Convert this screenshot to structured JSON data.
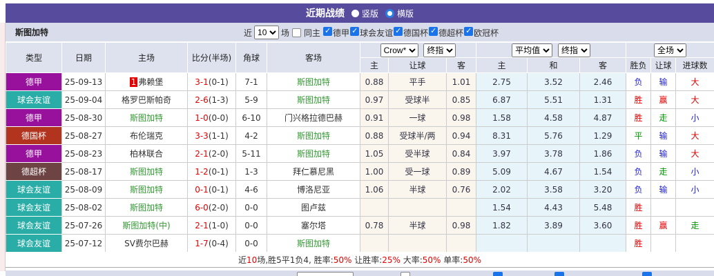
{
  "title_bar": {
    "title": "近期战绩",
    "radio_vertical": "竖版",
    "radio_horizontal": "横版",
    "selected": "横版"
  },
  "toolbar": {
    "team": "斯图加特",
    "near_label": "近",
    "near_value": "10",
    "games_label": "场",
    "same_home_label": "同主",
    "same_home_checked": false,
    "leagues": [
      {
        "label": "德甲",
        "checked": true
      },
      {
        "label": "球会友谊",
        "checked": true
      },
      {
        "label": "德国杯",
        "checked": true
      },
      {
        "label": "德超杯",
        "checked": true
      },
      {
        "label": "欧冠杯",
        "checked": true
      }
    ]
  },
  "header": {
    "static": [
      "类型",
      "日期",
      "主场",
      "比分(半场)",
      "角球",
      "客场"
    ],
    "odds_select_1": "Crow*",
    "odds_select_2": "终指",
    "avg_select_1": "平均值",
    "avg_select_2": "终指",
    "scope_select": "全场",
    "sub": [
      "主",
      "让球",
      "客",
      "主",
      "和",
      "客",
      "胜负",
      "让球",
      "进球数"
    ]
  },
  "type_colors": {
    "德甲": "#98119c",
    "球会友谊": "#29ada6",
    "德国杯": "#b2341f",
    "德超杯": "#6d4344"
  },
  "rows": [
    {
      "type": "德甲",
      "date": "25-09-13",
      "home": "弗赖堡",
      "home_rank": "1",
      "home_green": false,
      "score": "3-1",
      "half": "(0-1)",
      "corner": "7-1",
      "away": "斯图加特",
      "away_green": true,
      "odds": [
        "0.88",
        "平手",
        "1.01"
      ],
      "avg": [
        "2.75",
        "3.52",
        "2.46"
      ],
      "wdl": [
        "负",
        "blue"
      ],
      "let": [
        "输",
        "blue"
      ],
      "goals": [
        "大",
        "red"
      ]
    },
    {
      "type": "球会友谊",
      "date": "25-09-04",
      "home": "格罗巴斯帕奇",
      "home_rank": "",
      "home_green": false,
      "score": "2-6",
      "half": "(1-3)",
      "corner": "5-9",
      "away": "斯图加特",
      "away_green": true,
      "odds": [
        "0.97",
        "受球半",
        "0.85"
      ],
      "avg": [
        "6.87",
        "5.51",
        "1.31"
      ],
      "wdl": [
        "胜",
        "red"
      ],
      "let": [
        "赢",
        "red"
      ],
      "goals": [
        "大",
        "red"
      ]
    },
    {
      "type": "德甲",
      "date": "25-08-30",
      "home": "斯图加特",
      "home_rank": "",
      "home_green": true,
      "score": "1-0",
      "half": "(0-0)",
      "corner": "6-10",
      "away": "门兴格拉德巴赫",
      "away_green": false,
      "odds": [
        "0.91",
        "一球",
        "0.98"
      ],
      "avg": [
        "1.58",
        "4.58",
        "4.87"
      ],
      "wdl": [
        "胜",
        "red"
      ],
      "let": [
        "走",
        "green"
      ],
      "goals": [
        "小",
        "blue"
      ]
    },
    {
      "type": "德国杯",
      "date": "25-08-27",
      "home": "布伦瑞克",
      "home_rank": "",
      "home_green": false,
      "score": "3-3",
      "half": "(1-1)",
      "corner": "4-2",
      "away": "斯图加特",
      "away_green": true,
      "odds": [
        "0.88",
        "受球半/两",
        "0.94"
      ],
      "avg": [
        "8.31",
        "5.76",
        "1.29"
      ],
      "wdl": [
        "平",
        "green"
      ],
      "let": [
        "输",
        "blue"
      ],
      "goals": [
        "大",
        "red"
      ]
    },
    {
      "type": "德甲",
      "date": "25-08-23",
      "home": "柏林联合",
      "home_rank": "",
      "home_green": false,
      "score": "2-1",
      "half": "(2-0)",
      "corner": "5-11",
      "away": "斯图加特",
      "away_green": true,
      "odds": [
        "1.05",
        "受半球",
        "0.84"
      ],
      "avg": [
        "3.97",
        "3.78",
        "1.86"
      ],
      "wdl": [
        "负",
        "blue"
      ],
      "let": [
        "输",
        "blue"
      ],
      "goals": [
        "大",
        "red"
      ]
    },
    {
      "type": "德超杯",
      "date": "25-08-17",
      "home": "斯图加特",
      "home_rank": "",
      "home_green": true,
      "score": "1-2",
      "half": "(0-1)",
      "corner": "1-3",
      "away": "拜仁慕尼黑",
      "away_green": false,
      "odds": [
        "1.00",
        "受一球",
        "0.89"
      ],
      "avg": [
        "5.09",
        "4.67",
        "1.54"
      ],
      "wdl": [
        "负",
        "blue"
      ],
      "let": [
        "走",
        "green"
      ],
      "goals": [
        "小",
        "blue"
      ]
    },
    {
      "type": "球会友谊",
      "date": "25-08-09",
      "home": "斯图加特",
      "home_rank": "",
      "home_green": true,
      "score": "0-1",
      "half": "(0-1)",
      "corner": "4-6",
      "away": "博洛尼亚",
      "away_green": false,
      "odds": [
        "1.06",
        "半球",
        "0.76"
      ],
      "avg": [
        "2.02",
        "3.58",
        "3.20"
      ],
      "wdl": [
        "负",
        "blue"
      ],
      "let": [
        "输",
        "blue"
      ],
      "goals": [
        "小",
        "blue"
      ]
    },
    {
      "type": "球会友谊",
      "date": "25-08-02",
      "home": "斯图加特",
      "home_rank": "",
      "home_green": true,
      "score": "6-0",
      "half": "(2-0)",
      "corner": "0-0",
      "away": "图卢兹",
      "away_green": false,
      "odds": [
        "",
        "",
        ""
      ],
      "avg": [
        "1.54",
        "4.43",
        "5.48"
      ],
      "wdl": [
        "胜",
        "red"
      ],
      "let": [
        "",
        ""
      ],
      "goals": [
        "",
        ""
      ]
    },
    {
      "type": "球会友谊",
      "date": "25-07-26",
      "home": "斯图加特(中)",
      "home_rank": "",
      "home_green": true,
      "score": "2-1",
      "half": "(1-0)",
      "corner": "0-0",
      "away": "塞尔塔",
      "away_green": false,
      "odds": [
        "0.78",
        "半球",
        "0.98"
      ],
      "avg": [
        "1.82",
        "3.89",
        "3.60"
      ],
      "wdl": [
        "胜",
        "red"
      ],
      "let": [
        "赢",
        "red"
      ],
      "goals": [
        "走",
        "green"
      ]
    },
    {
      "type": "球会友谊",
      "date": "25-07-12",
      "home": "SV费尔巴赫",
      "home_rank": "",
      "home_green": false,
      "score": "1-7",
      "half": "(0-4)",
      "corner": "0-0",
      "away": "斯图加特",
      "away_green": true,
      "odds": [
        "",
        "",
        ""
      ],
      "avg": [
        "",
        "",
        ""
      ],
      "wdl": [
        "胜",
        "red"
      ],
      "let": [
        "",
        ""
      ],
      "goals": [
        "",
        ""
      ]
    }
  ],
  "footer_segments": [
    {
      "text": "近",
      "red": false
    },
    {
      "text": "10",
      "red": true
    },
    {
      "text": "场,胜5平1负4, 胜率:",
      "red": false
    },
    {
      "text": "50%",
      "red": true
    },
    {
      "text": " 让胜率:",
      "red": false
    },
    {
      "text": "25%",
      "red": true
    },
    {
      "text": " 大率:",
      "red": false
    },
    {
      "text": "50%",
      "red": true
    },
    {
      "text": " 单率:",
      "red": false
    },
    {
      "text": "50%",
      "red": true
    }
  ],
  "colors": {
    "title_bar_bg": "#574b9d",
    "toolbar_bg": "#d9dcea",
    "header_bg": "#dee2ee",
    "odds_col_bg": "#faf5ed",
    "avg_col_bg": "#e7f4fa",
    "win_red": "#e60000",
    "lose_blue": "#2222dd",
    "draw_green": "#009900",
    "team_green": "#339933"
  }
}
